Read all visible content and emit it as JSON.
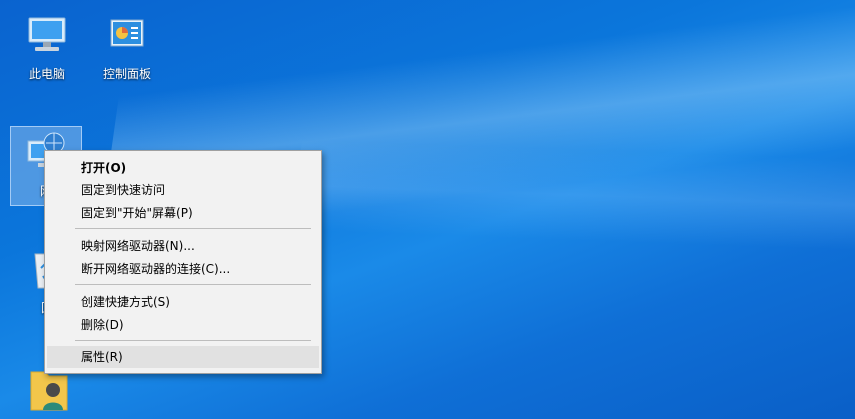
{
  "desktop": {
    "icons": [
      {
        "label": "此电脑",
        "icon": "this-pc-icon"
      },
      {
        "label": "控制面板",
        "icon": "control-panel-icon"
      },
      {
        "label": "网",
        "icon": "network-icon"
      },
      {
        "label": "回",
        "icon": "recycle-bin-icon"
      },
      {
        "label": "",
        "icon": "user-folder-icon"
      }
    ]
  },
  "context_menu": {
    "open": "打开(O)",
    "pin_quick_access": "固定到快速访问",
    "pin_start": "固定到\"开始\"屏幕(P)",
    "map_drive": "映射网络驱动器(N)...",
    "disconnect_drive": "断开网络驱动器的连接(C)...",
    "create_shortcut": "创建快捷方式(S)",
    "delete": "删除(D)",
    "properties": "属性(R)"
  }
}
